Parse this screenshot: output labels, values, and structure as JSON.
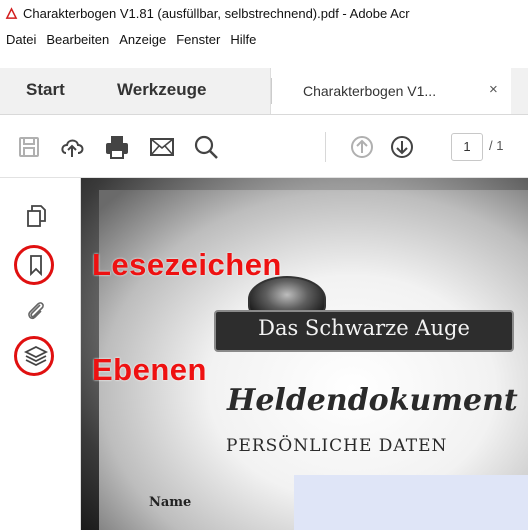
{
  "window": {
    "title": "Charakterbogen V1.81 (ausfüllbar, selbstrechnend).pdf - Adobe Acr"
  },
  "menu": [
    "Datei",
    "Bearbeiten",
    "Anzeige",
    "Fenster",
    "Hilfe"
  ],
  "tabs": {
    "home": "Start",
    "tools": "Werkzeuge",
    "document": "Charakterbogen V1...",
    "close": "×"
  },
  "toolbar": {
    "icons": [
      "save-icon",
      "cloud-upload-icon",
      "print-icon",
      "email-icon",
      "search-icon",
      "page-up-icon",
      "page-down-icon"
    ],
    "page_current": "1",
    "page_total": "/ 1"
  },
  "left_pane": {
    "icons": [
      "page-thumbnails-icon",
      "bookmark-icon",
      "attachment-icon",
      "layers-icon"
    ]
  },
  "annotations": {
    "bookmarks": "Lesezeichen",
    "layers": "Ebenen",
    "color": "#ee1111"
  },
  "document": {
    "logo": "Das Schwarze Auge",
    "title": "Heldendokument",
    "subtitle": "PERSÖNLICHE DATEN",
    "field_name": "Name"
  }
}
